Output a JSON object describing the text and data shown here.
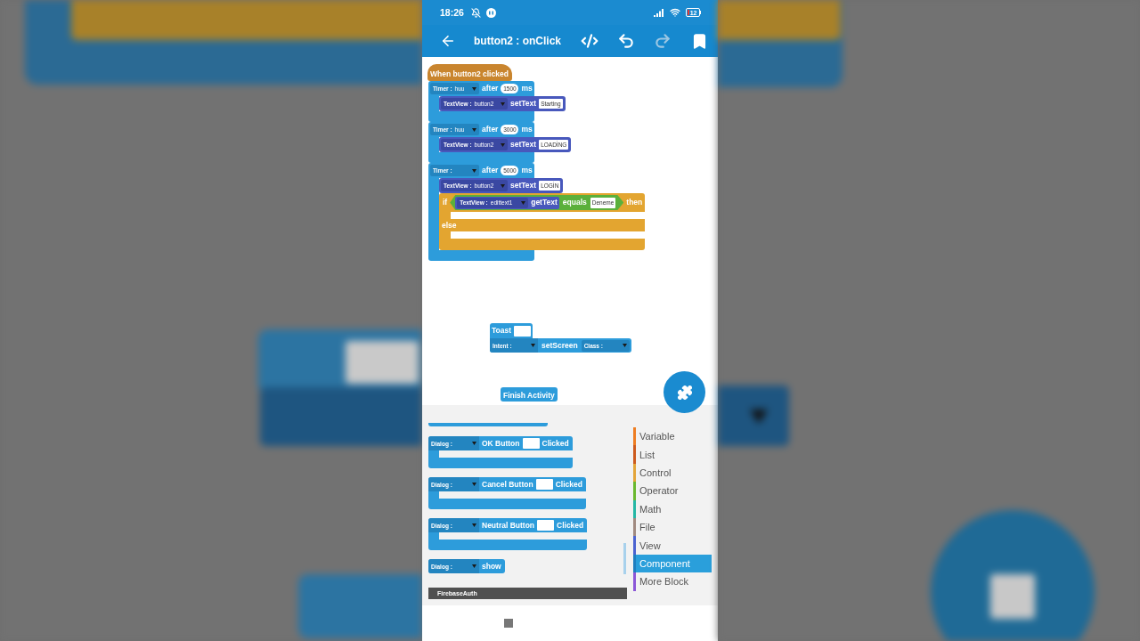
{
  "status_bar": {
    "time": "18:26",
    "battery": "12"
  },
  "toolbar": {
    "title": "button2 : onClick",
    "actions": [
      {
        "kind": "code",
        "disabled": false
      },
      {
        "kind": "undo",
        "disabled": false
      },
      {
        "kind": "redo",
        "disabled": true
      },
      {
        "kind": "bookmark",
        "disabled": false
      }
    ]
  },
  "canvas": {
    "event": {
      "label": "When button2 clicked",
      "timers": [
        {
          "label": "Timer :",
          "variable": "huu",
          "after": "after",
          "delay": "1500",
          "unit": "ms",
          "body": [
            {
              "kind": "set_text",
              "target_label": "TextView :",
              "target": "button2",
              "method": "setText",
              "value": "Starting"
            }
          ]
        },
        {
          "label": "Timer :",
          "variable": "huu",
          "after": "after",
          "delay": "3000",
          "unit": "ms",
          "body": [
            {
              "kind": "set_text",
              "target_label": "TextView :",
              "target": "button2",
              "method": "setText",
              "value": "LOADİNG"
            }
          ]
        },
        {
          "label": "Timer :",
          "after": "after",
          "delay": "5000",
          "unit": "ms",
          "body": [
            {
              "kind": "set_text",
              "target_label": "TextView :",
              "target": "button2",
              "method": "setText",
              "value": "LOGİN"
            },
            {
              "kind": "if_else",
              "if_label": "if",
              "condition": {
                "target_label": "TextView :",
                "target": "edittext1",
                "method": "getText",
                "operator": "equals",
                "value": "Deneme"
              },
              "then_label": "then",
              "else_label": "else"
            }
          ]
        }
      ]
    },
    "loose_stacks": [
      {
        "blocks": [
          {
            "kind": "toast",
            "label": "Toast"
          },
          {
            "kind": "set_screen",
            "intent_label": "Intent :",
            "method": "setScreen",
            "class_label": "Class :"
          }
        ]
      },
      {
        "blocks": [
          {
            "kind": "finish",
            "label": "Finish Activity"
          }
        ]
      }
    ]
  },
  "palette": {
    "blocks": [
      {
        "kind": "dialog_event",
        "target_label": "Dialog :",
        "button": "OK Button",
        "event": "Clicked"
      },
      {
        "kind": "dialog_event",
        "target_label": "Dialog :",
        "button": "Cancel Button",
        "event": "Clicked"
      },
      {
        "kind": "dialog_event",
        "target_label": "Dialog :",
        "button": "Neutral Button",
        "event": "Clicked"
      },
      {
        "kind": "dialog_call",
        "target_label": "Dialog :",
        "method": "show"
      }
    ],
    "section": "FirebaseAuth",
    "categories": [
      {
        "label": "Variable",
        "color": "#ee7d22",
        "selected": false
      },
      {
        "label": "List",
        "color": "#cc5a1e",
        "selected": false
      },
      {
        "label": "Control",
        "color": "#e3a53a",
        "selected": false
      },
      {
        "label": "Operator",
        "color": "#6bb82f",
        "selected": false
      },
      {
        "label": "Math",
        "color": "#25b7a5",
        "selected": false
      },
      {
        "label": "File",
        "color": "#a08a80",
        "selected": false
      },
      {
        "label": "View",
        "color": "#4b63d1",
        "selected": false
      },
      {
        "label": "Component",
        "color": "#1f7fc0",
        "selected": true
      },
      {
        "label": "More Block",
        "color": "#8b57d8",
        "selected": false
      }
    ]
  }
}
